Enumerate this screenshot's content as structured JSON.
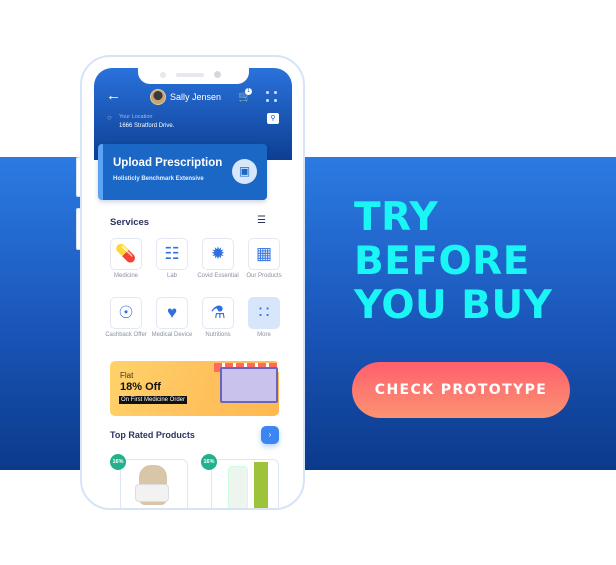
{
  "promo": {
    "headline": [
      "TRY",
      "BEFORE",
      "YOU BUY"
    ],
    "cta_label": "CHECK PROTOTYPE",
    "colors": {
      "band_top": "#2b7be3",
      "band_bottom": "#0b3a8a",
      "headline": "#1af5f5",
      "cta_start": "#ff5f6d",
      "cta_end": "#fb9372"
    }
  },
  "app": {
    "header": {
      "user_name": "Sally Jensen",
      "cart_count": "1",
      "location_label": "Your Location",
      "location_value": "1666  Stratford Drive."
    },
    "upload": {
      "title": "Upload Prescription",
      "subtitle": "Holisticly Benchmark Extensive"
    },
    "services": {
      "title": "Services",
      "items": [
        {
          "label": "Medicine",
          "icon": "pill-icon"
        },
        {
          "label": "Lab",
          "icon": "test-tube-icon"
        },
        {
          "label": "Covid Essential",
          "icon": "virus-icon"
        },
        {
          "label": "Our Products",
          "icon": "products-icon"
        },
        {
          "label": "Cashback Offer",
          "icon": "cashback-icon"
        },
        {
          "label": "Medical Device",
          "icon": "smartwatch-icon"
        },
        {
          "label": "Nutritions",
          "icon": "nutrition-icon"
        },
        {
          "label": "More",
          "icon": "grid-icon"
        }
      ]
    },
    "offer": {
      "flat": "Flat",
      "percent": "18% Off",
      "desc": "On First Medicine Order"
    },
    "top_rated": {
      "title": "Top Rated Products",
      "products": [
        {
          "discount": "16%"
        },
        {
          "discount": "16%"
        }
      ]
    }
  }
}
